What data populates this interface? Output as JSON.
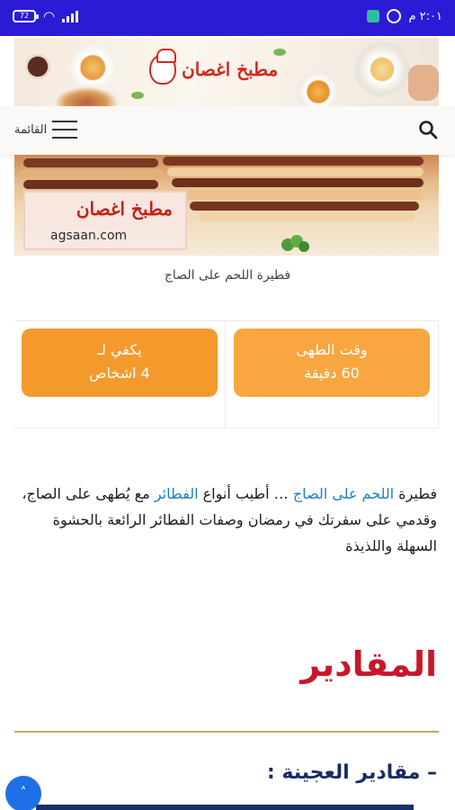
{
  "status_bar": {
    "battery_level": "72",
    "time": "٢:٠١ م"
  },
  "header": {
    "logo_text": "مطبخ اغصان"
  },
  "nav": {
    "menu_label": "القائمة"
  },
  "hero": {
    "card_title": "مطبخ اغصان",
    "site": "agsaan.com",
    "caption": "فطيرة اللحم على الصاج"
  },
  "info": {
    "time_label": "وقت الطهى",
    "time_value": "60 دقيقة",
    "serves_label": "يكفي لـ",
    "serves_value": "4 اشخاص"
  },
  "intro": {
    "part1": "فطيرة ",
    "link1": "اللحم على الصاج",
    "part2": " … أطيب أنواع ",
    "link2": "الفطائر",
    "part3": " مع يُطهى على الصاج، وقدمي على سفرتك في رمضان وصفات الفطائر الرائعة بالحشوة السهلة واللذيذة"
  },
  "section": {
    "title": "المقادير",
    "subtitle": "– مقادير العجينة :"
  },
  "scroll_top": {
    "icon": "chevron-up-icon",
    "glyph": "˄"
  },
  "colors": {
    "status_bar": "#2c1bd6",
    "accent_orange": "#f8a640",
    "section_red": "#c9162b",
    "link_blue": "#1f7fc2",
    "divider_gold": "#c8a85a"
  }
}
